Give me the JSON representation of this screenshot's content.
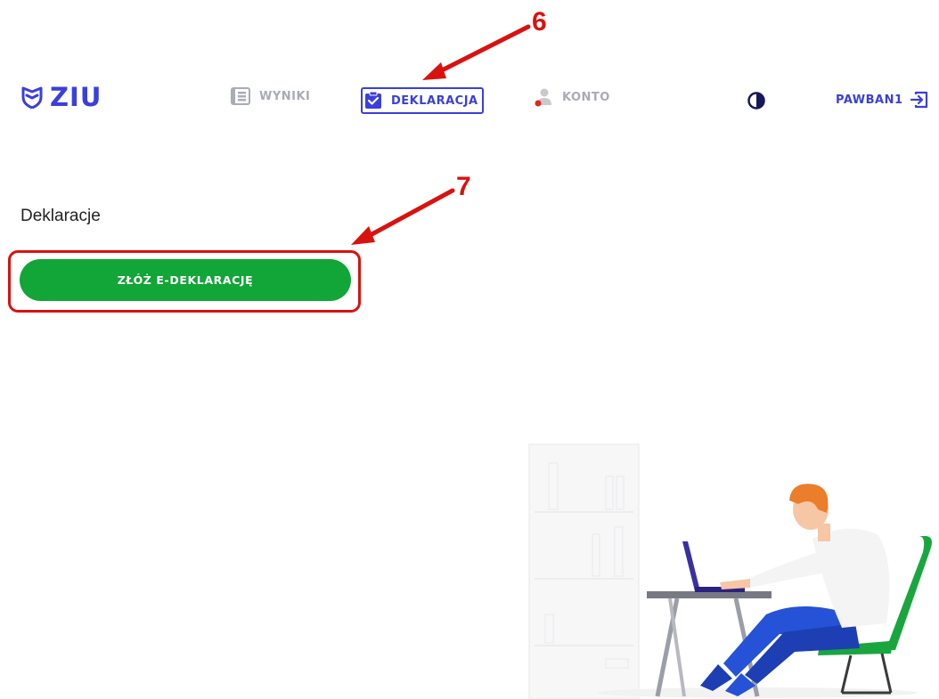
{
  "header": {
    "logo_text": "ZIU",
    "nav": [
      {
        "label": "WYNIKI",
        "icon": "list-icon",
        "active": false
      },
      {
        "label": "DEKLARACJA",
        "icon": "clipboard-check-icon",
        "active": true
      },
      {
        "label": "KONTO",
        "icon": "user-icon",
        "active": false
      }
    ],
    "contrast_icon": "contrast-icon",
    "username": "PAWBAN1",
    "logout_icon": "logout-icon"
  },
  "main": {
    "title": "Deklaracje",
    "submit_button": "ZŁÓŻ E-DEKLARACJĘ"
  },
  "annotations": {
    "step_6": "6",
    "step_7": "7"
  },
  "colors": {
    "brand": "#3a3fdc",
    "button_green": "#12a537",
    "annotation_red": "#d9120f",
    "inactive_nav": "#a9acb4"
  }
}
